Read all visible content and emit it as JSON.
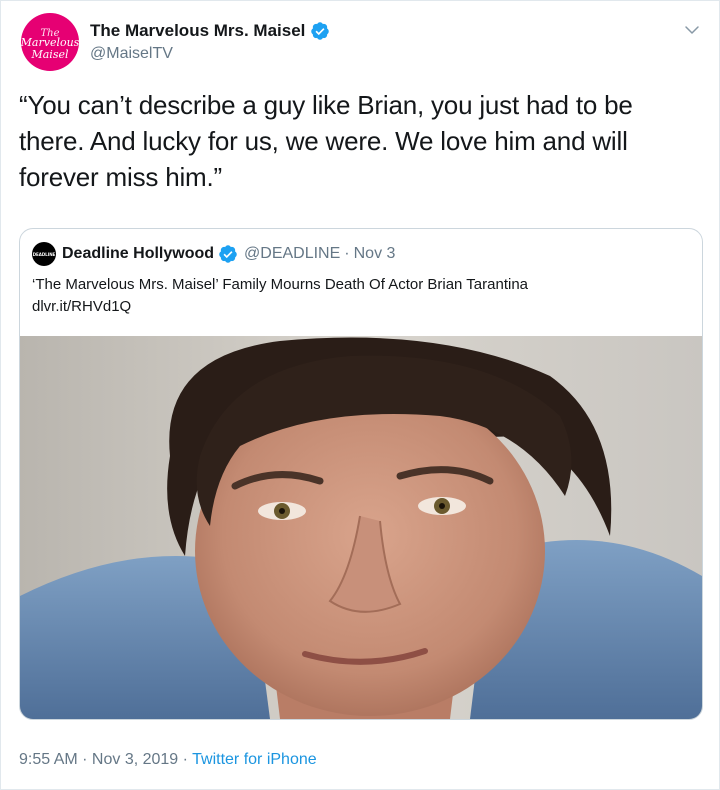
{
  "author": {
    "name": "The Marvelous Mrs. Maisel",
    "handle": "@MaiselTV",
    "avatar_logo": "The Marvelous Mrs. Maisel",
    "verified": true,
    "avatar_color": "#e60073"
  },
  "tweet": {
    "text": "“You can’t describe a guy like Brian, you just had to be there. And lucky for us, we were. We love him and will forever miss him.”"
  },
  "quoted": {
    "name": "Deadline Hollywood",
    "avatar_logo": "DEADLINE",
    "handle": "@DEADLINE",
    "separator": "·",
    "date": "Nov 3",
    "text": "‘The Marvelous Mrs. Maisel’ Family Mourns Death Of Actor Brian Tarantina",
    "link": "dlvr.it/RHVd1Q"
  },
  "footer": {
    "time": "9:55 AM",
    "sep1": " · ",
    "date": "Nov 3, 2019",
    "sep2": " · ",
    "app": "Twitter for iPhone"
  },
  "colors": {
    "verified_blue": "#1da1f2",
    "link_blue": "#1b95e0",
    "secondary_text": "#657786"
  },
  "icons": {
    "verified": "verified-badge-icon",
    "menu": "chevron-down-icon"
  }
}
